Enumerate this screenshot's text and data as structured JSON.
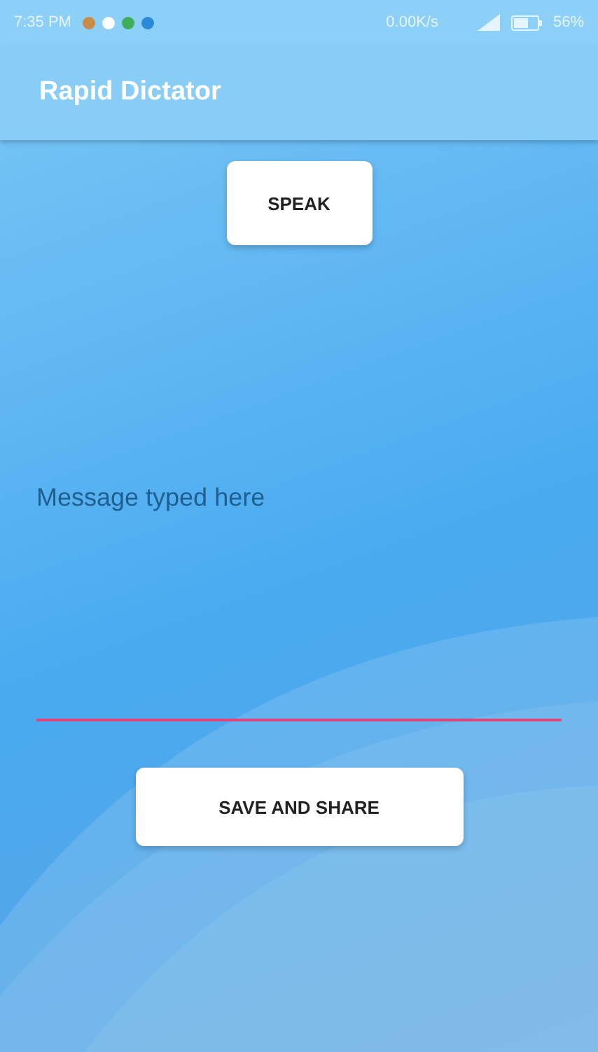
{
  "status_bar": {
    "time": "7:35 PM",
    "speed": "0.00K/s",
    "battery": "56%"
  },
  "app_bar": {
    "title": "Rapid Dictator"
  },
  "speak_button": {
    "label": "SPEAK"
  },
  "message_field": {
    "placeholder": "Message typed here"
  },
  "save_button": {
    "label": "SAVE AND SHARE"
  }
}
